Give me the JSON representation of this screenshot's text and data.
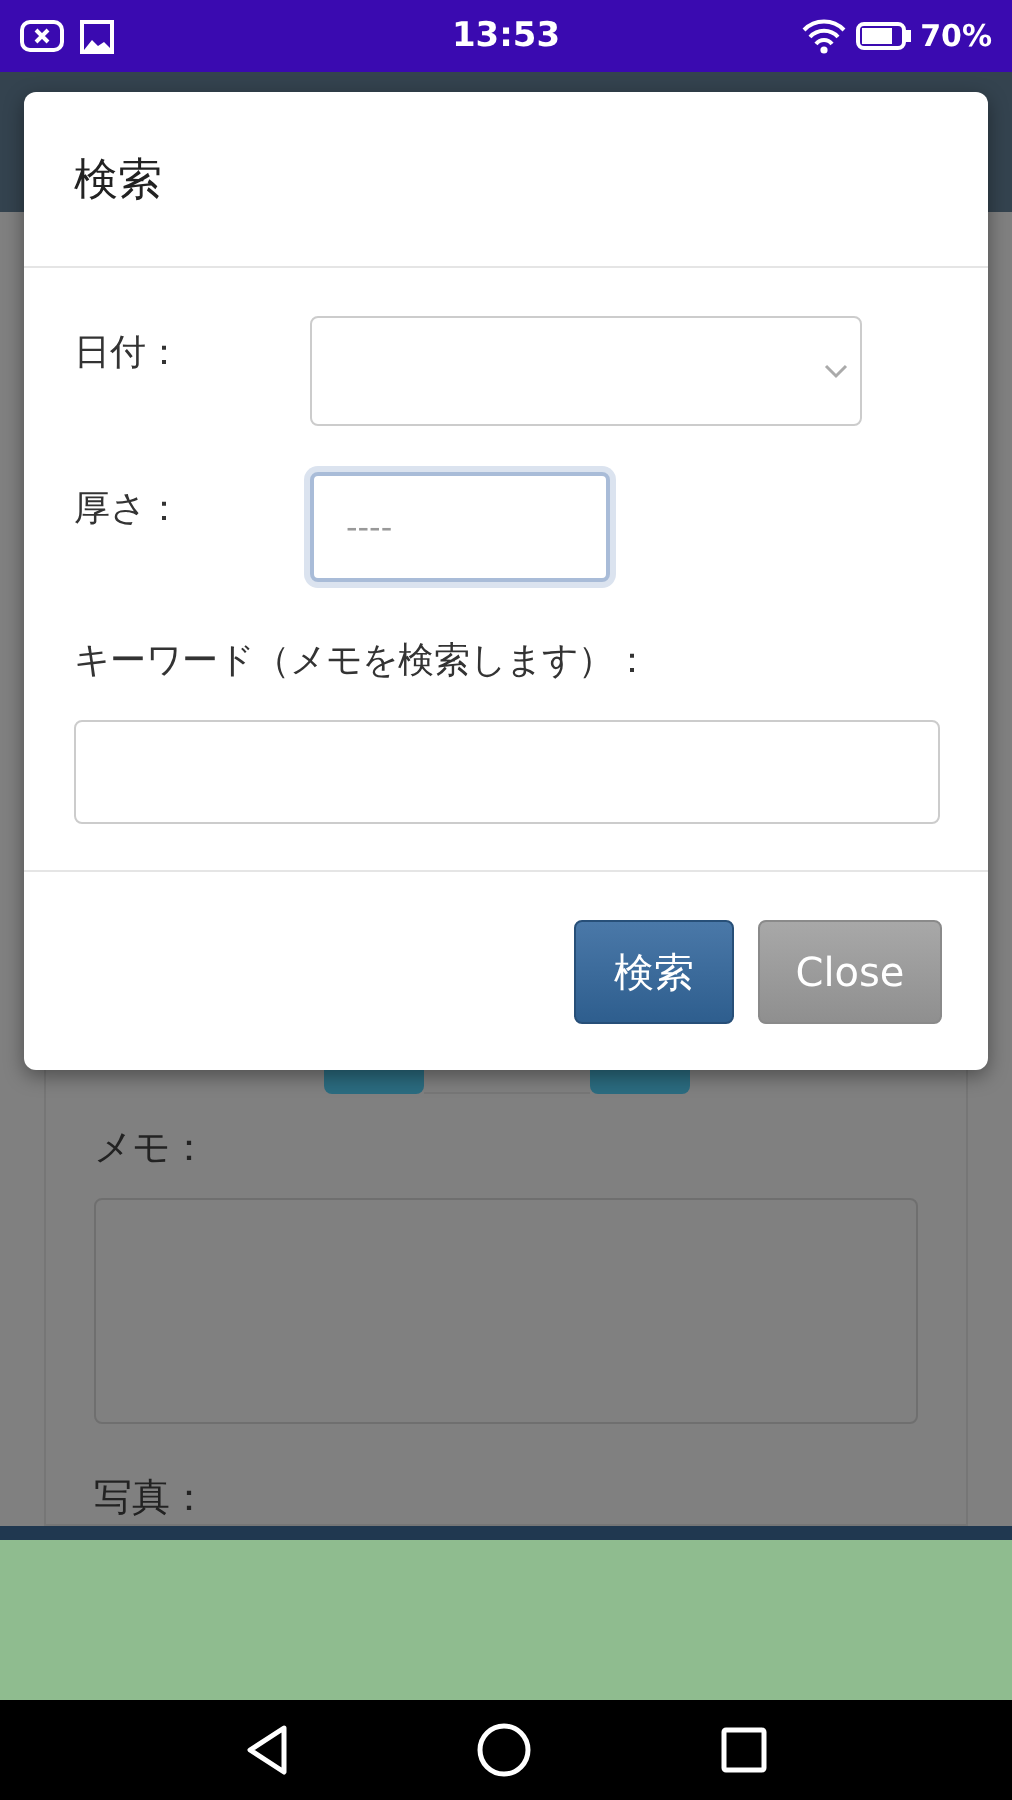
{
  "status_bar": {
    "time": "13:53",
    "battery": "70%"
  },
  "background": {
    "memo_label": "メモ：",
    "photo_label": "写真："
  },
  "modal": {
    "title": "検索",
    "fields": [
      {
        "label": "日付：",
        "kind": "select",
        "focused": false
      },
      {
        "label": "厚さ：",
        "kind": "text",
        "placeholder": "----",
        "focused": true
      },
      {
        "label": "キーワード（メモを検索します）：",
        "kind": "wide",
        "focused": false
      }
    ],
    "buttons": [
      {
        "label": "検索",
        "kind": "primary"
      },
      {
        "label": "Close",
        "kind": "secondary"
      }
    ]
  }
}
